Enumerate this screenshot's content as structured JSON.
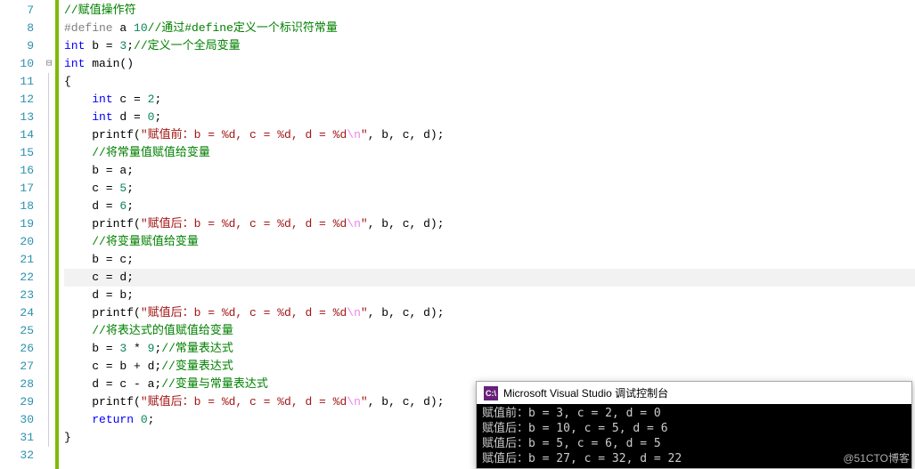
{
  "line_start": 7,
  "line_end": 32,
  "highlight_line": 22,
  "fold": {
    "line": 10,
    "glyph": "⊟"
  },
  "code_lines": [
    {
      "n": 7,
      "tokens": [
        {
          "t": "//赋值操作符",
          "c": "cm"
        }
      ]
    },
    {
      "n": 8,
      "tokens": [
        {
          "t": "#define",
          "c": "pp"
        },
        {
          "t": " ",
          "c": "id"
        },
        {
          "t": "a",
          "c": "id"
        },
        {
          "t": " ",
          "c": "id"
        },
        {
          "t": "10",
          "c": "num"
        },
        {
          "t": "//通过#define定义一个标识符常量",
          "c": "cm"
        }
      ]
    },
    {
      "n": 9,
      "tokens": [
        {
          "t": "int",
          "c": "kw"
        },
        {
          "t": " b = ",
          "c": "id"
        },
        {
          "t": "3",
          "c": "num"
        },
        {
          "t": ";",
          "c": "id"
        },
        {
          "t": "//定义一个全局变量",
          "c": "cm"
        }
      ]
    },
    {
      "n": 10,
      "tokens": [
        {
          "t": "int",
          "c": "kw"
        },
        {
          "t": " main()",
          "c": "id"
        }
      ]
    },
    {
      "n": 11,
      "tokens": [
        {
          "t": "{",
          "c": "id"
        }
      ]
    },
    {
      "n": 12,
      "tokens": [
        {
          "t": "    ",
          "c": "id"
        },
        {
          "t": "int",
          "c": "kw"
        },
        {
          "t": " c = ",
          "c": "id"
        },
        {
          "t": "2",
          "c": "num"
        },
        {
          "t": ";",
          "c": "id"
        }
      ]
    },
    {
      "n": 13,
      "tokens": [
        {
          "t": "    ",
          "c": "id"
        },
        {
          "t": "int",
          "c": "kw"
        },
        {
          "t": " d = ",
          "c": "id"
        },
        {
          "t": "0",
          "c": "num"
        },
        {
          "t": ";",
          "c": "id"
        }
      ]
    },
    {
      "n": 14,
      "tokens": [
        {
          "t": "    printf(",
          "c": "id"
        },
        {
          "t": "\"赋值前：b = %d, c = %d, d = %d",
          "c": "str"
        },
        {
          "t": "\\n",
          "c": "esc"
        },
        {
          "t": "\"",
          "c": "str"
        },
        {
          "t": ", b, c, d);",
          "c": "id"
        }
      ]
    },
    {
      "n": 15,
      "tokens": [
        {
          "t": "    ",
          "c": "id"
        },
        {
          "t": "//将常量值赋值给变量",
          "c": "cm"
        }
      ]
    },
    {
      "n": 16,
      "tokens": [
        {
          "t": "    b = a;",
          "c": "id"
        }
      ]
    },
    {
      "n": 17,
      "tokens": [
        {
          "t": "    c = ",
          "c": "id"
        },
        {
          "t": "5",
          "c": "num"
        },
        {
          "t": ";",
          "c": "id"
        }
      ]
    },
    {
      "n": 18,
      "tokens": [
        {
          "t": "    d = ",
          "c": "id"
        },
        {
          "t": "6",
          "c": "num"
        },
        {
          "t": ";",
          "c": "id"
        }
      ]
    },
    {
      "n": 19,
      "tokens": [
        {
          "t": "    printf(",
          "c": "id"
        },
        {
          "t": "\"赋值后：b = %d, c = %d, d = %d",
          "c": "str"
        },
        {
          "t": "\\n",
          "c": "esc"
        },
        {
          "t": "\"",
          "c": "str"
        },
        {
          "t": ", b, c, d);",
          "c": "id"
        }
      ]
    },
    {
      "n": 20,
      "tokens": [
        {
          "t": "    ",
          "c": "id"
        },
        {
          "t": "//将变量赋值给变量",
          "c": "cm"
        }
      ]
    },
    {
      "n": 21,
      "tokens": [
        {
          "t": "    b = c;",
          "c": "id"
        }
      ]
    },
    {
      "n": 22,
      "tokens": [
        {
          "t": "    c = d;",
          "c": "id"
        }
      ]
    },
    {
      "n": 23,
      "tokens": [
        {
          "t": "    d = b;",
          "c": "id"
        }
      ]
    },
    {
      "n": 24,
      "tokens": [
        {
          "t": "    printf(",
          "c": "id"
        },
        {
          "t": "\"赋值后：b = %d, c = %d, d = %d",
          "c": "str"
        },
        {
          "t": "\\n",
          "c": "esc"
        },
        {
          "t": "\"",
          "c": "str"
        },
        {
          "t": ", b, c, d);",
          "c": "id"
        }
      ]
    },
    {
      "n": 25,
      "tokens": [
        {
          "t": "    ",
          "c": "id"
        },
        {
          "t": "//将表达式的值赋值给变量",
          "c": "cm"
        }
      ]
    },
    {
      "n": 26,
      "tokens": [
        {
          "t": "    b = ",
          "c": "id"
        },
        {
          "t": "3",
          "c": "num"
        },
        {
          "t": " * ",
          "c": "id"
        },
        {
          "t": "9",
          "c": "num"
        },
        {
          "t": ";",
          "c": "id"
        },
        {
          "t": "//常量表达式",
          "c": "cm"
        }
      ]
    },
    {
      "n": 27,
      "tokens": [
        {
          "t": "    c = b + d;",
          "c": "id"
        },
        {
          "t": "//变量表达式",
          "c": "cm"
        }
      ]
    },
    {
      "n": 28,
      "tokens": [
        {
          "t": "    d = c - a;",
          "c": "id"
        },
        {
          "t": "//变量与常量表达式",
          "c": "cm"
        }
      ]
    },
    {
      "n": 29,
      "tokens": [
        {
          "t": "    printf(",
          "c": "id"
        },
        {
          "t": "\"赋值后：b = %d, c = %d, d = %d",
          "c": "str"
        },
        {
          "t": "\\n",
          "c": "esc"
        },
        {
          "t": "\"",
          "c": "str"
        },
        {
          "t": ", b, c, d);",
          "c": "id"
        }
      ]
    },
    {
      "n": 30,
      "tokens": [
        {
          "t": "    ",
          "c": "id"
        },
        {
          "t": "return",
          "c": "kw"
        },
        {
          "t": " ",
          "c": "id"
        },
        {
          "t": "0",
          "c": "num"
        },
        {
          "t": ";",
          "c": "id"
        }
      ]
    },
    {
      "n": 31,
      "tokens": [
        {
          "t": "}",
          "c": "id"
        }
      ]
    },
    {
      "n": 32,
      "tokens": []
    }
  ],
  "console": {
    "icon_text": "C:\\",
    "title": "Microsoft Visual Studio 调试控制台",
    "lines": [
      "赋值前：b = 3, c = 2, d = 0",
      "赋值后：b = 10, c = 5, d = 6",
      "赋值后：b = 5, c = 6, d = 5",
      "赋值后：b = 27, c = 32, d = 22"
    ]
  },
  "watermark": "@51CTO博客"
}
